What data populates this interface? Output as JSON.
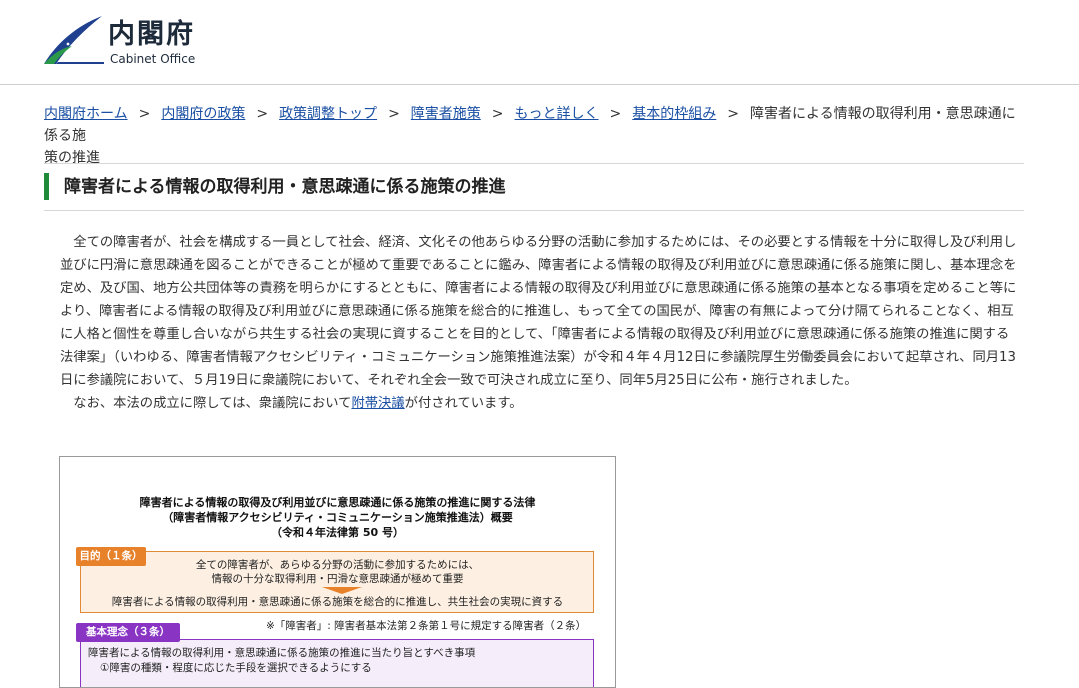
{
  "header": {
    "logo_ja": "内閣府",
    "logo_en": "Cabinet Office"
  },
  "breadcrumb": {
    "items": [
      {
        "label": "内閣府ホーム"
      },
      {
        "label": "内閣府の政策"
      },
      {
        "label": "政策調整トップ"
      },
      {
        "label": "障害者施策"
      },
      {
        "label": "もっと詳しく"
      },
      {
        "label": "基本的枠組み"
      }
    ],
    "separator": ">",
    "current_part1": "障害者による情報の取得利用・意思疎通に係る施",
    "current_part2": "策の推進"
  },
  "page": {
    "title": "障害者による情報の取得利用・意思疎通に係る施策の推進",
    "para1": "全ての障害者が、社会を構成する一員として社会、経済、文化その他あらゆる分野の活動に参加するためには、その必要とする情報を十分に取得し及び利用し並びに円滑に意思疎通を図ることができることが極めて重要であることに鑑み、障害者による情報の取得及び利用並びに意思疎通に係る施策に関し、基本理念を定め、及び国、地方公共団体等の責務を明らかにするとともに、障害者による情報の取得及び利用並びに意思疎通に係る施策の基本となる事項を定めること等により、障害者による情報の取得及び利用並びに意思疎通に係る施策を総合的に推進し、もって全ての国民が、障害の有無によって分け隔てられることなく、相互に人格と個性を尊重し合いながら共生する社会の実現に資することを目的として、「障害者による情報の取得及び利用並びに意思疎通に係る施策の推進に関する法律案」（いわゆる、障害者情報アクセシビリティ・コミュニケーション施策推進法案）が令和４年４月12日に参議院厚生労働委員会において起草され、同月13日に参議院において、５月19日に衆議院において、それぞれ全会一致で可決され成立に至り、同年5月25日に公布・施行されました。",
    "para2_before": "なお、本法の成立に際しては、衆議院において",
    "para2_link": "附帯決議",
    "para2_after": "が付されています。"
  },
  "figure": {
    "title_l1": "障害者による情報の取得及び利用並びに意思疎通に係る施策の推進に関する法律",
    "title_l2": "（障害者情報アクセシビリティ・コミュニケーション施策推進法）概要",
    "title_l3": "（令和４年法律第 50 号）",
    "purpose_tag": "目的（１条）",
    "purpose_l1": "全ての障害者が、あらゆる分野の活動に参加するためには、",
    "purpose_l2": "情報の十分な取得利用・円滑な意思疎通が極めて重要",
    "purpose_l3": "障害者による情報の取得利用・意思疎通に係る施策を総合的に推進し、共生社会の実現に資する",
    "note": "※「障害者」: 障害者基本法第２条第１号に規定する障害者（２条）",
    "basic_tag": "基本理念（３条）",
    "basic_l1": "障害者による情報の取得利用・意思疎通に係る施策の推進に当たり旨とすべき事項",
    "basic_l2": "①障害の種類・程度に応じた手段を選択できるようにする"
  },
  "colors": {
    "link": "#1a4fa3",
    "title_accent": "#1e8a3a",
    "purpose": "#e8822a",
    "basic": "#8a34c4"
  }
}
